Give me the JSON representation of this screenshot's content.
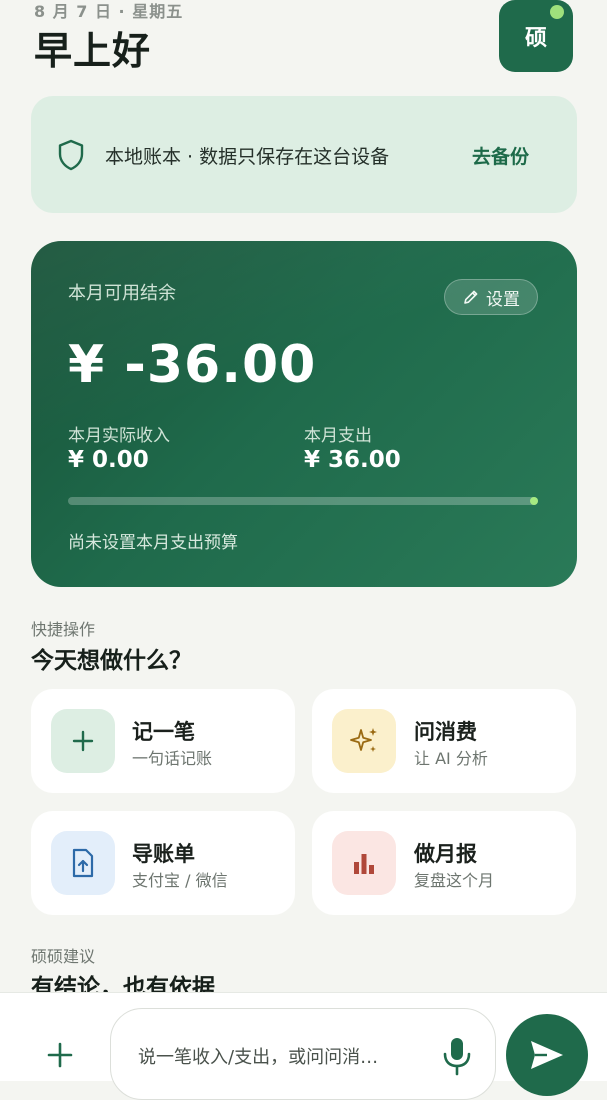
{
  "header": {
    "date": "8 月 7 日 · 星期五",
    "greeting": "早上好",
    "avatar_text": "硕"
  },
  "notice": {
    "icon": "shield-icon",
    "text": "本地账本 · 数据只保存在这台设备",
    "link": "去备份"
  },
  "balance": {
    "label": "本月可用结余",
    "settings_label": "设置",
    "amount": "¥ -36.00",
    "income_label": "本月实际收入",
    "income_value": "¥ 0.00",
    "expense_label": "本月支出",
    "expense_value": "¥ 36.00",
    "budget_note": "尚未设置本月支出预算"
  },
  "quick_actions": {
    "kicker": "快捷操作",
    "title": "今天想做什么？",
    "items": [
      {
        "name": "记一笔",
        "sub": "一句话记账",
        "icon": "plus-icon"
      },
      {
        "name": "问消费",
        "sub": "让 AI 分析",
        "icon": "sparkle-icon"
      },
      {
        "name": "导账单",
        "sub": "支付宝 / 微信",
        "icon": "upload-file-icon"
      },
      {
        "name": "做月报",
        "sub": "复盘这个月",
        "icon": "bar-chart-icon"
      }
    ]
  },
  "suggestions": {
    "kicker": "硕硕建议",
    "title": "有结论，也有依据"
  },
  "composer": {
    "placeholder": "说一笔收入/支出，或问问消…"
  },
  "colors": {
    "brand": "#1f6a4b",
    "notice_bg": "#ddeee3",
    "accent_dot": "#9fe07c"
  }
}
